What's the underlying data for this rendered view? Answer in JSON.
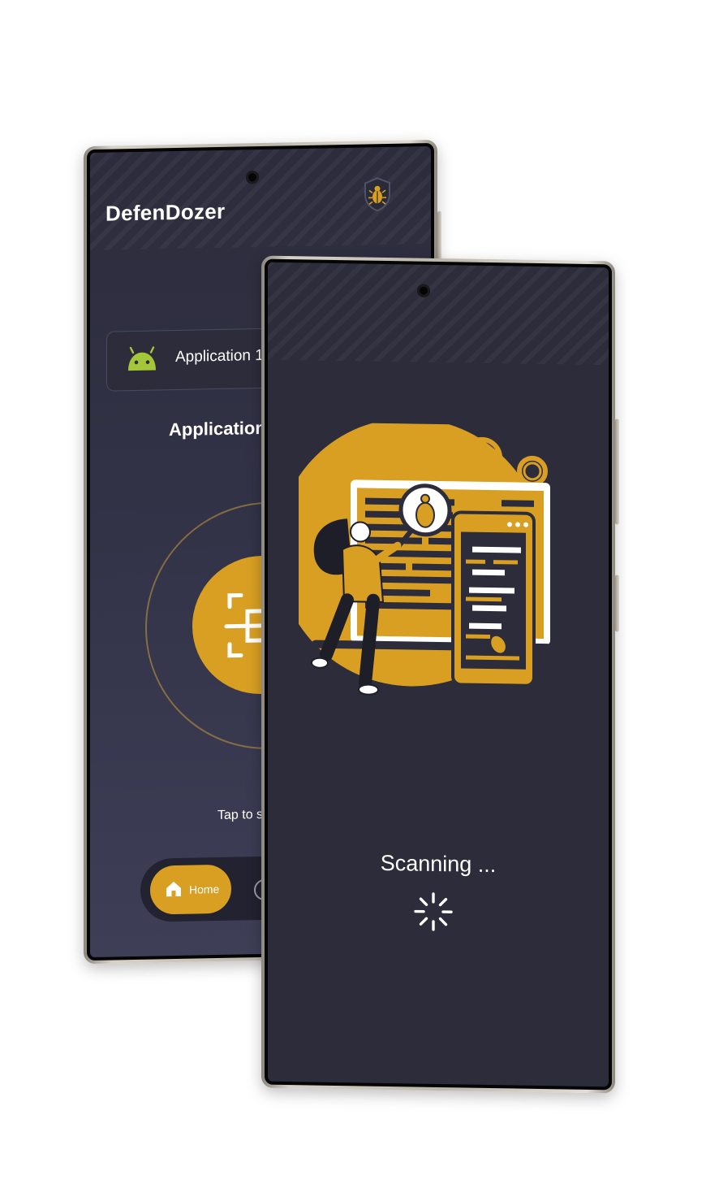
{
  "back_screen": {
    "app_title": "DefenDozer",
    "app_card_label": "Application 1",
    "section_title": "Application",
    "tap_hint": "Tap to s",
    "nav": {
      "home_label": "Home"
    }
  },
  "front_screen": {
    "status_text": "Scanning ..."
  },
  "colors": {
    "accent": "#d89f22",
    "screen_bg": "#2c2c3b",
    "android_green": "#a4c639"
  },
  "icons": {
    "shield": "bug-shield-icon",
    "android": "android-icon",
    "scan": "scan-document-icon",
    "home": "home-icon",
    "spinner": "loading-spinner-icon"
  }
}
